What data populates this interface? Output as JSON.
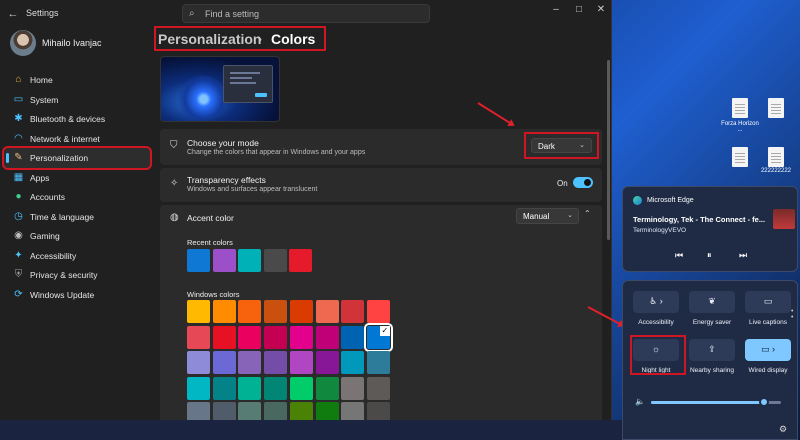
{
  "window": {
    "title": "Settings",
    "search_placeholder": "Find a setting",
    "controls": [
      "–",
      "□",
      "✕"
    ]
  },
  "user": {
    "name": "Mihailo Ivanjac"
  },
  "sidebar": {
    "items": [
      {
        "label": "Home",
        "icon": "home-icon",
        "glyph": "⌂",
        "color": "#e9a94b",
        "active": false
      },
      {
        "label": "System",
        "icon": "monitor-icon",
        "glyph": "▭",
        "color": "#4cc2ff",
        "active": false
      },
      {
        "label": "Bluetooth & devices",
        "icon": "bluetooth-icon",
        "glyph": "✱",
        "color": "#4cc2ff",
        "active": false
      },
      {
        "label": "Network & internet",
        "icon": "wifi-icon",
        "glyph": "◠",
        "color": "#4cc2ff",
        "active": false
      },
      {
        "label": "Personalization",
        "icon": "brush-icon",
        "glyph": "✎",
        "color": "#e8c08a",
        "active": true
      },
      {
        "label": "Apps",
        "icon": "apps-icon",
        "glyph": "▦",
        "color": "#4cc2ff",
        "active": false
      },
      {
        "label": "Accounts",
        "icon": "person-icon",
        "glyph": "●",
        "color": "#3fd18b",
        "active": false
      },
      {
        "label": "Time & language",
        "icon": "globe-clock-icon",
        "glyph": "◷",
        "color": "#4cc2ff",
        "active": false
      },
      {
        "label": "Gaming",
        "icon": "controller-icon",
        "glyph": "◉",
        "color": "#bdbdbd",
        "active": false
      },
      {
        "label": "Accessibility",
        "icon": "accessibility-icon",
        "glyph": "✦",
        "color": "#4cc2ff",
        "active": false
      },
      {
        "label": "Privacy & security",
        "icon": "shield-icon",
        "glyph": "⛨",
        "color": "#9e9e9e",
        "active": false
      },
      {
        "label": "Windows Update",
        "icon": "update-icon",
        "glyph": "⟳",
        "color": "#4cc2ff",
        "active": false
      }
    ]
  },
  "breadcrumb": {
    "parent": "Personalization",
    "separator": "›",
    "current": "Colors"
  },
  "mode": {
    "title": "Choose your mode",
    "desc": "Change the colors that appear in Windows and your apps",
    "value": "Dark"
  },
  "transparency": {
    "title": "Transparency effects",
    "desc": "Windows and surfaces appear translucent",
    "state": "On"
  },
  "accent": {
    "title": "Accent color",
    "value": "Manual",
    "recent_label": "Recent colors",
    "recent": [
      "#0f78d4",
      "#9b4fc8",
      "#00b2b8",
      "#4a4a4a",
      "#e51a2a"
    ],
    "windows_label": "Windows colors",
    "windows_rows": [
      [
        "#ffb900",
        "#ff8c00",
        "#f7630c",
        "#ca5010",
        "#da3b01",
        "#ef6950",
        "#d13438",
        "#ff4343"
      ],
      [
        "#e74856",
        "#e81123",
        "#ea005e",
        "#c30052",
        "#e3008c",
        "#bf0077",
        "#0063b1",
        "#0078d4"
      ],
      [
        "#8e8cd8",
        "#6b69d6",
        "#8764b8",
        "#744da9",
        "#b146c2",
        "#881798",
        "#0099bc",
        "#2d7d9a"
      ],
      [
        "#00b7c3",
        "#038387",
        "#00b294",
        "#018574",
        "#00cc6a",
        "#10893e",
        "#7a7574",
        "#5d5a58"
      ],
      [
        "#68768a",
        "#515c6b",
        "#567c73",
        "#486860",
        "#498205",
        "#107c10",
        "#767676",
        "#4c4a48"
      ]
    ],
    "selected_row": 1,
    "selected_col": 7
  },
  "media": {
    "app": "Microsoft Edge",
    "song": "Terminology, Tek - The Connect - fe...",
    "artist": "TerminologyVEVO",
    "prev": "⏮",
    "play": "⏸",
    "next": "⏭"
  },
  "quick_settings": {
    "tiles": [
      {
        "label": "Accessibility",
        "icon": "accessibility-icon",
        "glyph": "♿ ›",
        "on": false
      },
      {
        "label": "Energy saver",
        "icon": "leaf-icon",
        "glyph": "❦",
        "on": false
      },
      {
        "label": "Live captions",
        "icon": "captions-icon",
        "glyph": "▭",
        "on": false
      },
      {
        "label": "Night light",
        "icon": "brightness-icon",
        "glyph": "☼",
        "on": false
      },
      {
        "label": "Nearby sharing",
        "icon": "share-icon",
        "glyph": "⇪",
        "on": false
      },
      {
        "label": "Wired display",
        "icon": "display-icon",
        "glyph": "▭ ›",
        "on": true
      }
    ],
    "volume_icon": "🔈",
    "volume_level": 0.87,
    "settings_icon": "⚙"
  },
  "desktop": {
    "icons": [
      {
        "label": "Forza Horizon ..."
      },
      {
        "label": ""
      },
      {
        "label": ""
      },
      {
        "label": "222222222"
      }
    ]
  },
  "colors": {
    "accent": "#4cc2ff",
    "highlight": "#d01622"
  }
}
